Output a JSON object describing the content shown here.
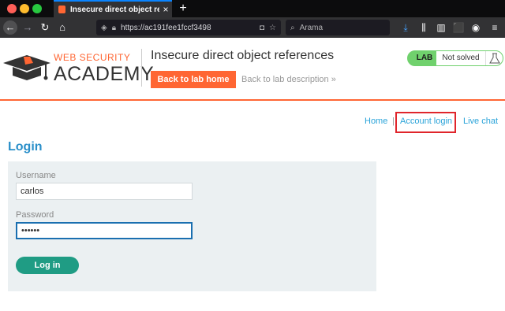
{
  "browser": {
    "tab_title": "Insecure direct object referenc",
    "tab_close": "×",
    "new_tab": "+",
    "url": "https://ac191fee1fccf3498",
    "search_placeholder": "Arama"
  },
  "header": {
    "logo_top": "WEB SECURITY",
    "logo_bottom": "ACADEMY",
    "lab_title": "Insecure direct object references",
    "back_home_label": "Back to lab home",
    "back_desc_label": "Back to lab description »",
    "status_lab": "LAB",
    "status_text": "Not solved"
  },
  "nav": {
    "home": "Home",
    "separator": "|",
    "account_login": "Account login",
    "live_chat": "Live chat"
  },
  "login": {
    "heading": "Login",
    "username_label": "Username",
    "username_value": "carlos",
    "password_label": "Password",
    "password_value": "••••••",
    "submit_label": "Log in"
  },
  "colors": {
    "accent_orange": "#ff6633",
    "link_blue": "#29a3d9",
    "status_green": "#70d16d",
    "button_teal": "#1f9c84",
    "highlight_red": "#e0252b"
  }
}
